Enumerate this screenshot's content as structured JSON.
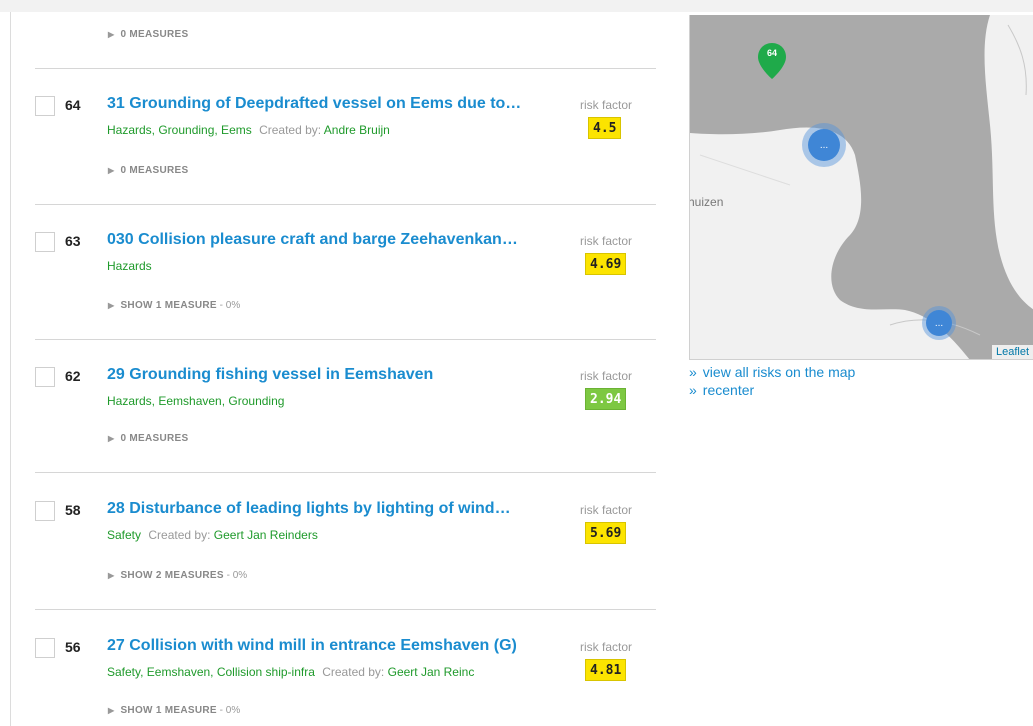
{
  "risks": [
    {
      "num": "64",
      "title": "31 Grounding of Deepdrafted vessel on Eems due to…",
      "tags": "Hazards, Grounding, Eems",
      "created_label": "Created by:",
      "author": "Andre Bruijn",
      "rf_label": "risk factor",
      "rf_value": "4.5",
      "rf_color": "#fce400",
      "measures": "0 MEASURES",
      "measures_pct": ""
    },
    {
      "num": "63",
      "title": "030 Collision pleasure craft and barge Zeehavenkan…",
      "tags": "Hazards",
      "created_label": "",
      "author": "",
      "rf_label": "risk factor",
      "rf_value": "4.69",
      "rf_color": "#fce400",
      "measures": "SHOW 1 MEASURE",
      "measures_pct": " - 0%"
    },
    {
      "num": "62",
      "title": "29 Grounding fishing vessel in Eemshaven",
      "tags": "Hazards, Eemshaven, Grounding",
      "created_label": "",
      "author": "",
      "rf_label": "risk factor",
      "rf_value": "2.94",
      "rf_color": "#7dc842",
      "measures": "0 MEASURES",
      "measures_pct": ""
    },
    {
      "num": "58",
      "title": "28 Disturbance of leading lights by lighting of wind…",
      "tags": "Safety",
      "created_label": "Created by:",
      "author": "Geert Jan Reinders",
      "rf_label": "risk factor",
      "rf_value": "5.69",
      "rf_color": "#fce400",
      "measures": "SHOW 2 MEASURES",
      "measures_pct": " - 0%"
    },
    {
      "num": "56",
      "title": "27 Collision with wind mill in entrance Eemshaven (G)",
      "tags": "Safety, Eemshaven, Collision ship-infra",
      "created_label": "Created by:",
      "author": "Geert Jan Reinc",
      "rf_label": "risk factor",
      "rf_value": "4.81",
      "rf_color": "#fce400",
      "measures": "SHOW 1 MEASURE",
      "measures_pct": " - 0%"
    }
  ],
  "top_measures": "0 MEASURES",
  "map": {
    "pin_label": "64",
    "pin_color": "#1faa4a",
    "cluster_label": "...",
    "place_label": "huizen",
    "attribution": "Leaflet",
    "water_color": "#aaaaaa",
    "land_color": "#f1f1f1"
  },
  "links": {
    "view_all": "view all risks on the map",
    "recenter": "recenter",
    "arrow": "»"
  }
}
